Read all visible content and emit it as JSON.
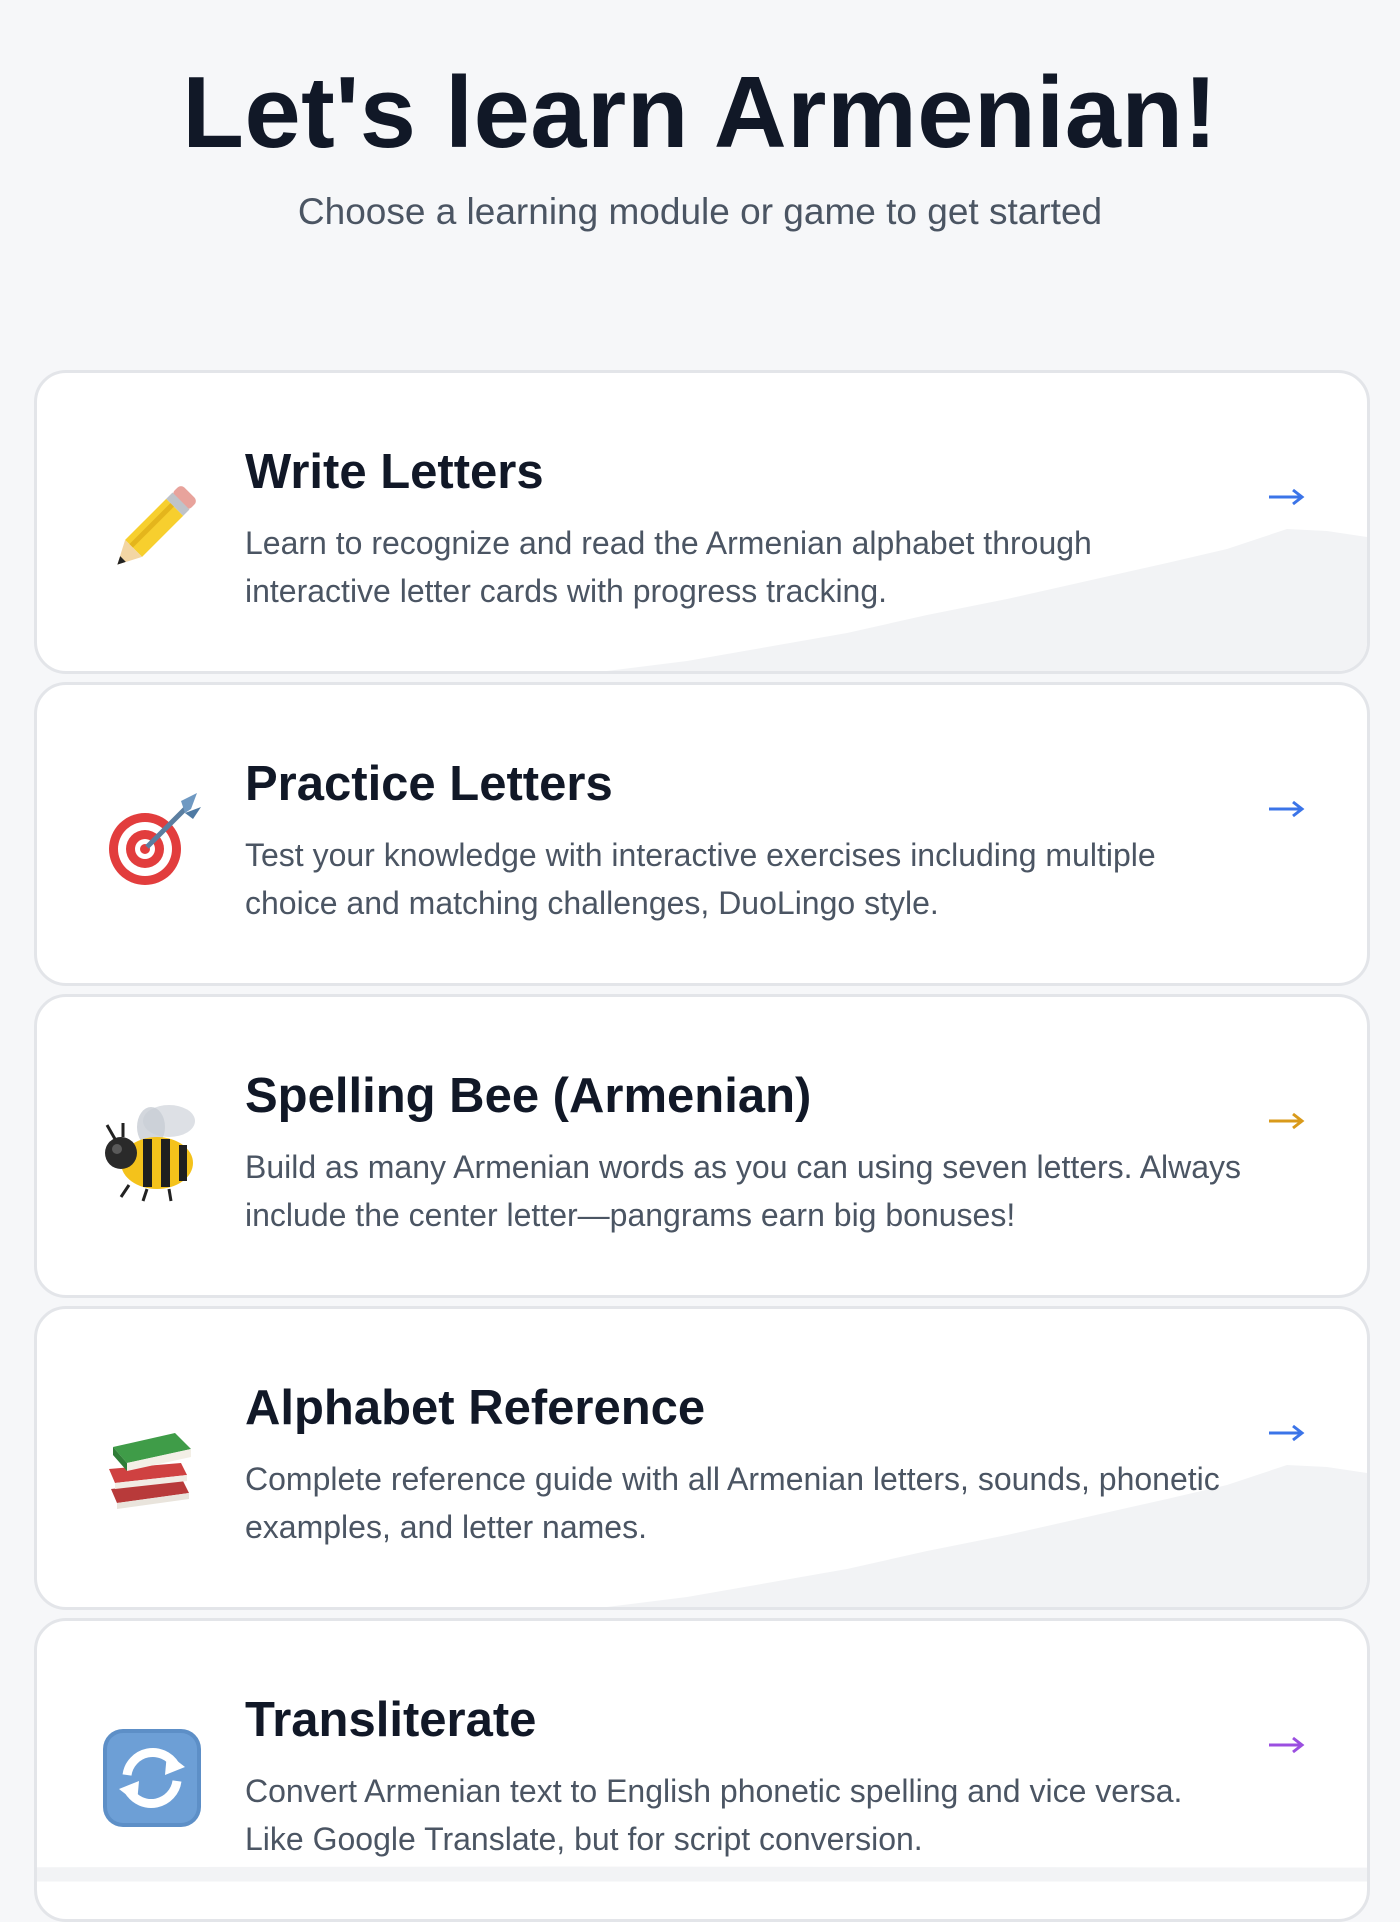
{
  "header": {
    "title": "Let's learn Armenian!",
    "subtitle": "Choose a learning module or game to get started"
  },
  "modules": [
    {
      "title": "Write Letters",
      "description": "Learn to recognize and read the Armenian alphabet through interactive letter cards with progress tracking.",
      "icon": "pencil-icon",
      "arrow_color": "#3b74e8"
    },
    {
      "title": "Practice Letters",
      "description": "Test your knowledge with interactive exercises including multiple choice and matching challenges, DuoLingo style.",
      "icon": "target-dart-icon",
      "arrow_color": "#3b74e8"
    },
    {
      "title": "Spelling Bee (Armenian)",
      "description": "Build as many Armenian words as you can using seven letters. Always include the center letter—pangrams earn big bonuses!",
      "icon": "bee-icon",
      "arrow_color": "#d99a1a"
    },
    {
      "title": "Alphabet Reference",
      "description": "Complete reference guide with all Armenian letters, sounds, phonetic examples, and letter names.",
      "icon": "books-icon",
      "arrow_color": "#3b74e8"
    },
    {
      "title": "Transliterate",
      "description": "Convert Armenian text to English phonetic spelling and vice versa. Like Google Translate, but for script conversion.",
      "icon": "refresh-icon",
      "arrow_color": "#9b4fe0"
    }
  ]
}
